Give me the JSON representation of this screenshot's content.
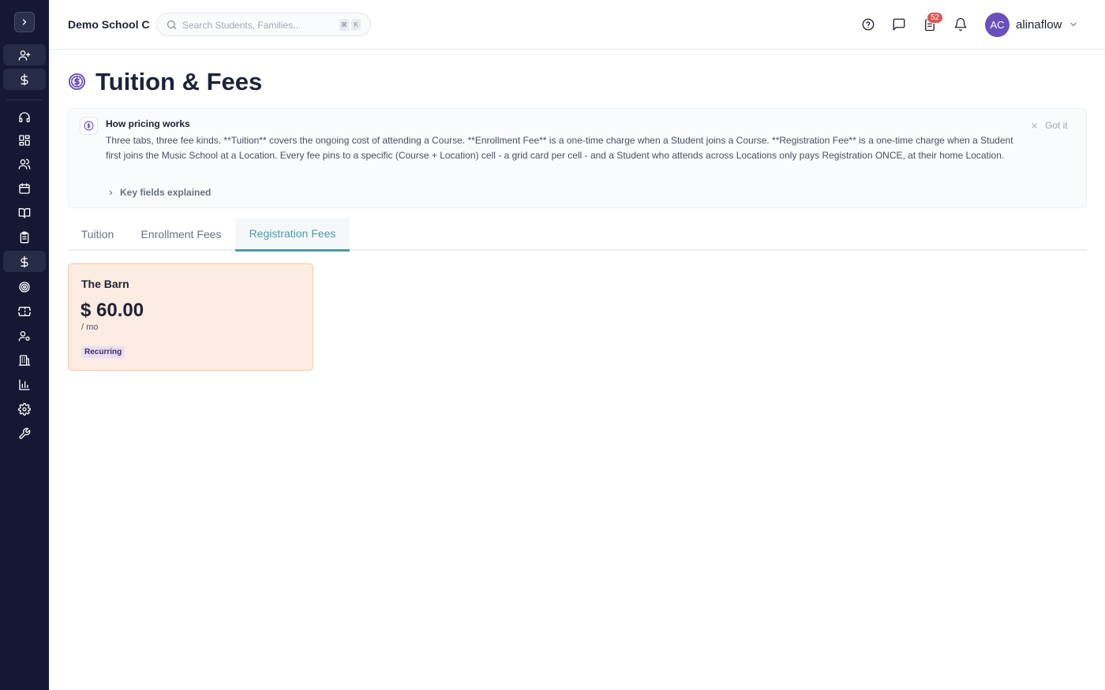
{
  "sidebar": {
    "items": [
      {
        "icon": "user-plus-icon"
      },
      {
        "icon": "dollar-icon"
      },
      {
        "icon": "headset-icon"
      },
      {
        "icon": "dashboard-icon"
      },
      {
        "icon": "users-icon"
      },
      {
        "icon": "calendar-icon"
      },
      {
        "icon": "book-icon"
      },
      {
        "icon": "clipboard-icon"
      },
      {
        "icon": "dollar-icon"
      },
      {
        "icon": "target-icon"
      },
      {
        "icon": "ticket-icon"
      },
      {
        "icon": "user-cog-icon"
      },
      {
        "icon": "building-icon"
      },
      {
        "icon": "bar-chart-icon"
      },
      {
        "icon": "gear-icon"
      },
      {
        "icon": "wrench-icon"
      }
    ]
  },
  "header": {
    "school_name": "Demo School C",
    "search_placeholder": "Search Students, Families...",
    "search_value": "",
    "shortcut_keys": [
      "⌘",
      "K"
    ],
    "tasks_badge": "52",
    "avatar_initials": "AC",
    "username": "alinaflow"
  },
  "page": {
    "title": "Tuition & Fees"
  },
  "info_banner": {
    "title": "How pricing works",
    "body": "Three tabs, three fee kinds. **Tuition** covers the ongoing cost of attending a Course. **Enrollment Fee** is a one-time charge when a Student joins a Course. **Registration Fee** is a one-time charge when a Student first joins the Music School at a Location. Every fee pins to a specific (Course + Location) cell - a grid card per cell - and a Student who attends across Locations only pays Registration ONCE, at their home Location.",
    "dismiss_label": "Got it",
    "key_fields_label": "Key fields explained"
  },
  "tabs": [
    {
      "label": "Tuition",
      "active": false
    },
    {
      "label": "Enrollment Fees",
      "active": false
    },
    {
      "label": "Registration Fees",
      "active": true
    }
  ],
  "fee_cards": [
    {
      "location": "The Barn",
      "amount": "$ 60.00",
      "period": "/ mo",
      "tag": "Recurring"
    }
  ],
  "colors": {
    "sidebar_bg": "#141832",
    "accent": "#4b9aa8",
    "brand_purple": "#6b4fbb",
    "badge_red": "#e05252",
    "card_bg": "#fdece2",
    "card_border": "#f5c7a7"
  }
}
